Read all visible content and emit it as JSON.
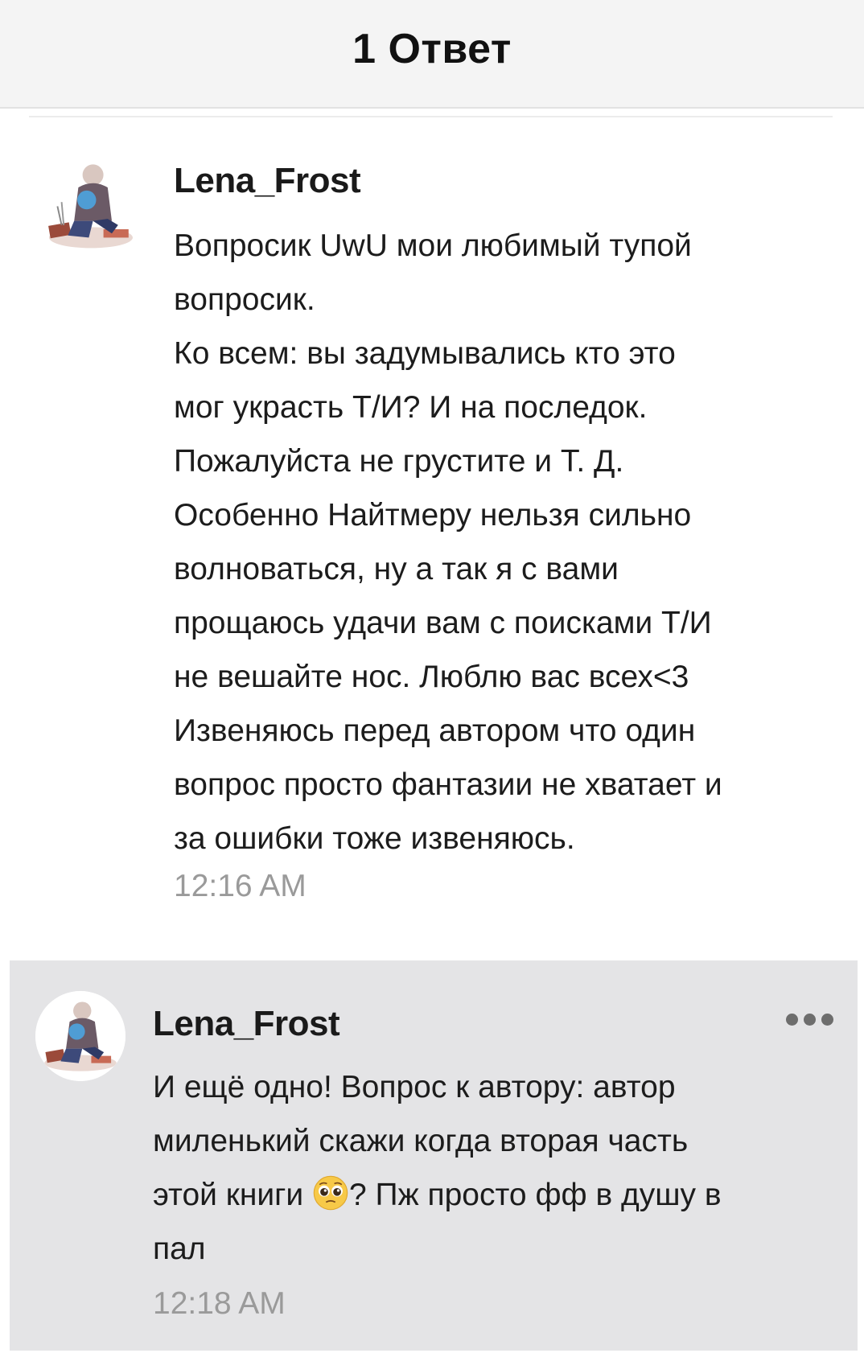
{
  "header": {
    "title": "1 Ответ"
  },
  "comments": [
    {
      "username": "Lena_Frost",
      "text": "Вопросик UwU мои любимый тупой\nвопросик.\nКо всем: вы задумывались кто это\nмог украсть Т/И? И на последок.\nПожалуйста не грустите и Т. Д.\nОсобенно Найтмеру нельзя сильно\nволноваться, ну а так я с вами\nпрощаюсь удачи вам с поисками Т/И\nне вешайте нос. Люблю вас всех<3\nИзвеняюсь перед автором что один\nвопрос просто фантазии не хватает и\nза ошибки тоже извеняюсь.",
      "time": "12:16 AM"
    },
    {
      "username": "Lena_Frost",
      "text_before_emoji": "И ещё одно! Вопрос к автору: автор\nмиленький скажи когда вторая часть\nэтой книги ",
      "emoji": "pleading-face-icon",
      "text_after_emoji": "? Пж просто фф в душу в\nпал",
      "time": "12:18 AM"
    }
  ],
  "colors": {
    "header_bg": "#f4f4f4",
    "highlight_bg": "#e4e4e6",
    "timestamp": "#9a9a9a"
  }
}
